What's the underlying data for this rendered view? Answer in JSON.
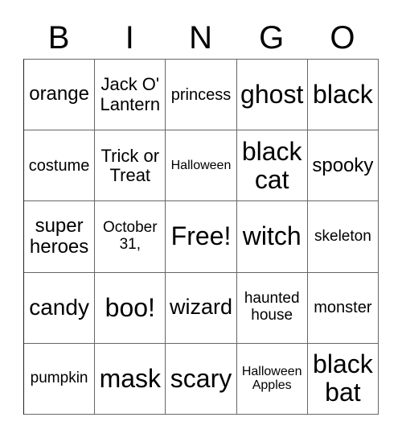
{
  "header": [
    "B",
    "I",
    "N",
    "G",
    "O"
  ],
  "cells": [
    {
      "text": "orange",
      "size": 24
    },
    {
      "text": "Jack O' Lantern",
      "size": 22
    },
    {
      "text": "princess",
      "size": 20
    },
    {
      "text": "ghost",
      "size": 32
    },
    {
      "text": "black",
      "size": 32
    },
    {
      "text": "costume",
      "size": 20
    },
    {
      "text": "Trick or Treat",
      "size": 22
    },
    {
      "text": "Halloween",
      "size": 16
    },
    {
      "text": "black cat",
      "size": 32
    },
    {
      "text": "spooky",
      "size": 24
    },
    {
      "text": "super heroes",
      "size": 24
    },
    {
      "text": "October 31,",
      "size": 19
    },
    {
      "text": "Free!",
      "size": 32
    },
    {
      "text": "witch",
      "size": 32
    },
    {
      "text": "skeleton",
      "size": 19
    },
    {
      "text": "candy",
      "size": 28
    },
    {
      "text": "boo!",
      "size": 32
    },
    {
      "text": "wizard",
      "size": 27
    },
    {
      "text": "haunted house",
      "size": 19
    },
    {
      "text": "monster",
      "size": 20
    },
    {
      "text": "pumpkin",
      "size": 19
    },
    {
      "text": "mask",
      "size": 32
    },
    {
      "text": "scary",
      "size": 32
    },
    {
      "text": "Halloween Apples",
      "size": 16
    },
    {
      "text": "black bat",
      "size": 32
    }
  ]
}
